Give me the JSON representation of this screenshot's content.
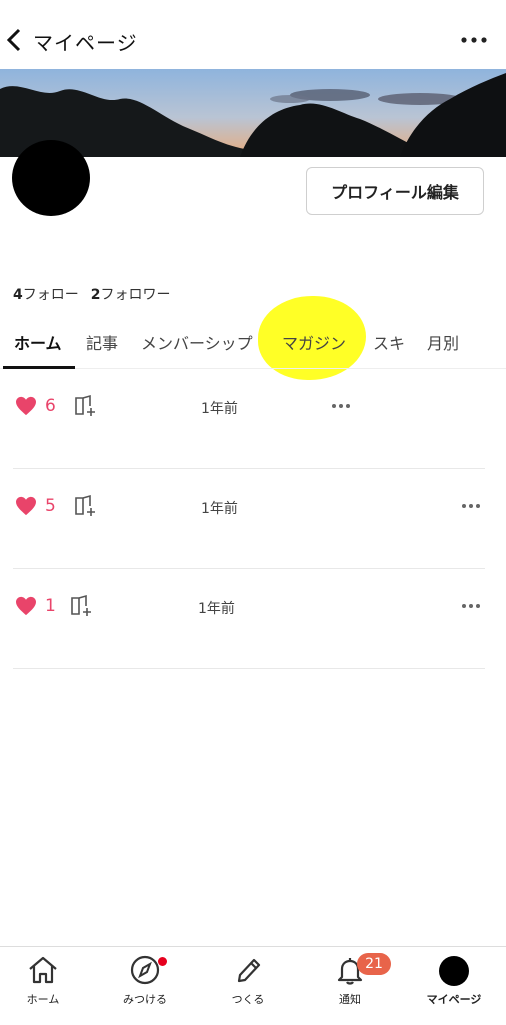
{
  "header": {
    "title": "マイページ"
  },
  "profile": {
    "edit_button": "プロフィール編集",
    "follow_count": "4",
    "follow_label": "フォロー",
    "follower_count": "2",
    "follower_label": "フォロワー"
  },
  "tabs": [
    {
      "label": "ホーム",
      "active": true
    },
    {
      "label": "記事"
    },
    {
      "label": "メンバーシップ"
    },
    {
      "label": "マガジン"
    },
    {
      "label": "スキ"
    },
    {
      "label": "月別"
    }
  ],
  "items": [
    {
      "likes": "6",
      "time": "1年前"
    },
    {
      "likes": "5",
      "time": "1年前"
    },
    {
      "likes": "1",
      "time": "1年前"
    }
  ],
  "bottom_nav": [
    {
      "label": "ホーム",
      "icon": "home-icon"
    },
    {
      "label": "みつける",
      "icon": "compass-icon"
    },
    {
      "label": "つくる",
      "icon": "pencil-icon"
    },
    {
      "label": "通知",
      "icon": "bell-icon",
      "badge": "21"
    },
    {
      "label": "マイページ",
      "icon": "avatar-icon",
      "active": true
    }
  ],
  "colors": {
    "like": "#e9446a",
    "badge": "#e8644a",
    "highlight": "#ffff1a"
  }
}
